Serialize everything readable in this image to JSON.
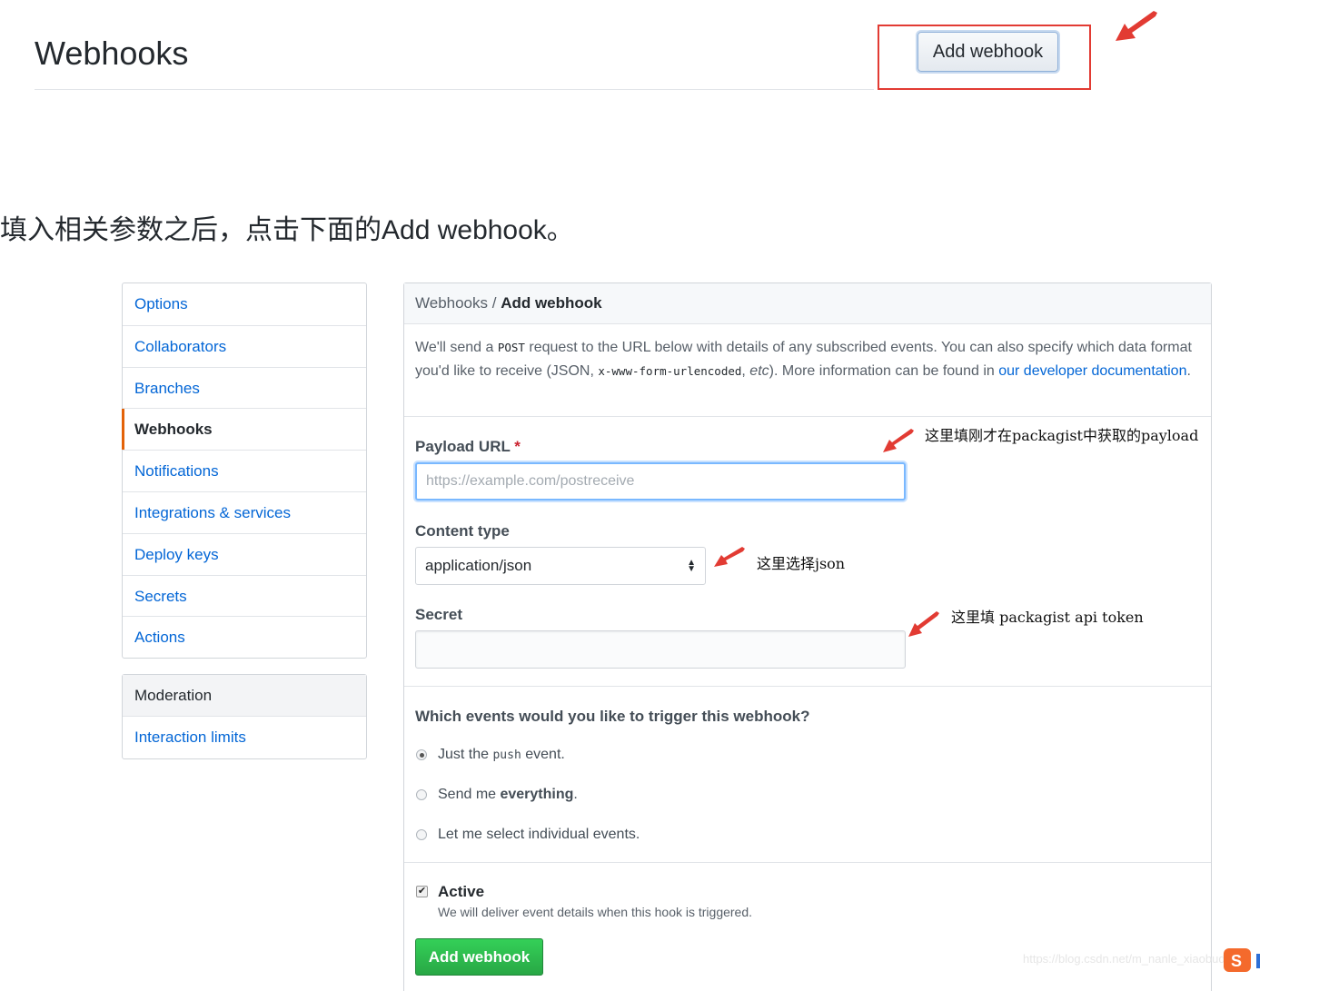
{
  "header": {
    "title": "Webhooks",
    "add_button": "Add webhook"
  },
  "instruction": "填入相关参数之后，点击下面的Add webhook。",
  "sidebar": {
    "items": [
      {
        "label": "Options"
      },
      {
        "label": "Collaborators"
      },
      {
        "label": "Branches"
      },
      {
        "label": "Webhooks",
        "selected": true
      },
      {
        "label": "Notifications"
      },
      {
        "label": "Integrations & services"
      },
      {
        "label": "Deploy keys"
      },
      {
        "label": "Secrets"
      },
      {
        "label": "Actions"
      }
    ],
    "moderation_heading": "Moderation",
    "moderation_items": [
      {
        "label": "Interaction limits"
      }
    ]
  },
  "main": {
    "breadcrumb_parent": "Webhooks",
    "breadcrumb_sep": " / ",
    "breadcrumb_current": "Add webhook",
    "desc_1": "We'll send a ",
    "desc_post": "POST",
    "desc_2": " request to the URL below with details of any subscribed events. You can also specify which data format you'd like to receive (JSON, ",
    "desc_code": "x-www-form-urlencoded",
    "desc_3": ", ",
    "desc_etc": "etc",
    "desc_4": "). More information can be found in ",
    "desc_link": "our developer documentation",
    "desc_5": ".",
    "payload_label": "Payload URL",
    "payload_required": "*",
    "payload_placeholder": "https://example.com/postreceive",
    "content_type_label": "Content type",
    "content_type_value": "application/json",
    "secret_label": "Secret",
    "events_question": "Which events would you like to trigger this webhook?",
    "event_push_1": "Just the ",
    "event_push_code": "push",
    "event_push_2": " event.",
    "event_everything_1": "Send me ",
    "event_everything_bold": "everything",
    "event_everything_2": ".",
    "event_individual": "Let me select individual events.",
    "selected_event": "push",
    "active_label": "Active",
    "active_checked": true,
    "active_note": "We will deliver event details when this hook is triggered.",
    "submit_label": "Add webhook"
  },
  "annotations": {
    "payload": "这里填刚才在packagist中获取的payload",
    "content_type": "这里选择json",
    "secret": "这里填 packagist api token"
  },
  "watermark": "https://blog.csdn.net/m_nanle_xiaobudi",
  "colors": {
    "link": "#0366d6",
    "submit_green": "#28a745",
    "annotation_red": "#e23b33",
    "selected_bar": "#e36209"
  }
}
